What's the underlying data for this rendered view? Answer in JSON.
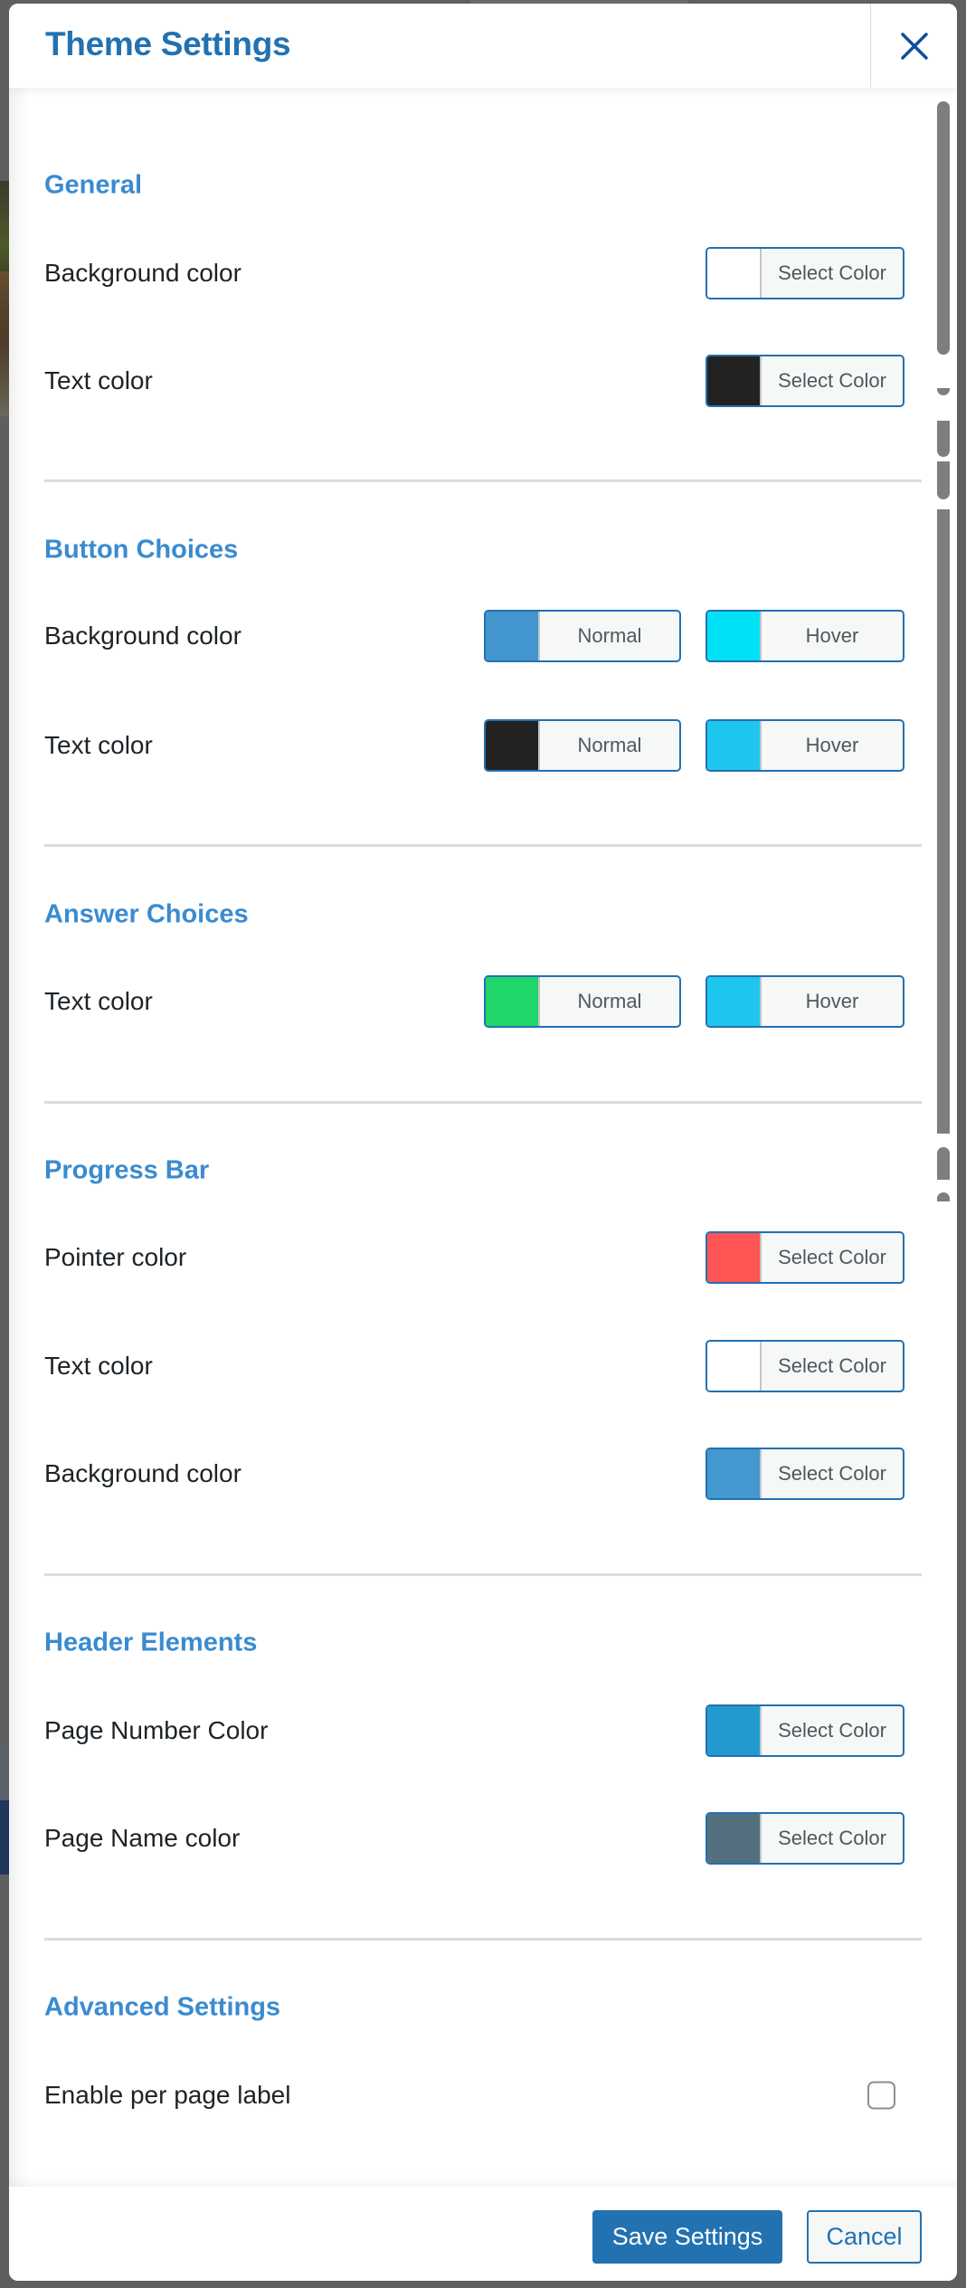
{
  "modal": {
    "title": "Theme Settings",
    "close_icon": "close-icon"
  },
  "sections": {
    "general": {
      "title": "General",
      "rows": [
        {
          "label": "Background color",
          "button_label": "Select Color",
          "color": "#ffffff"
        },
        {
          "label": "Text color",
          "button_label": "Select Color",
          "color": "#222222"
        }
      ]
    },
    "button_choices": {
      "title": "Button Choices",
      "rows": [
        {
          "label": "Background color",
          "normal_label": "Normal",
          "normal_color": "#4396cd",
          "hover_label": "Hover",
          "hover_color": "#00e1f5"
        },
        {
          "label": "Text color",
          "normal_label": "Normal",
          "normal_color": "#222222",
          "hover_label": "Hover",
          "hover_color": "#1ec6ef"
        }
      ]
    },
    "answer_choices": {
      "title": "Answer Choices",
      "rows": [
        {
          "label": "Text color",
          "normal_label": "Normal",
          "normal_color": "#1fd66b",
          "hover_label": "Hover",
          "hover_color": "#1ec6ef"
        }
      ]
    },
    "progress_bar": {
      "title": "Progress Bar",
      "rows": [
        {
          "label": "Pointer color",
          "button_label": "Select Color",
          "color": "#ff5454"
        },
        {
          "label": "Text color",
          "button_label": "Select Color",
          "color": "#ffffff"
        },
        {
          "label": "Background color",
          "button_label": "Select Color",
          "color": "#4399cf"
        }
      ]
    },
    "header_elements": {
      "title": "Header Elements",
      "rows": [
        {
          "label": "Page Number Color",
          "button_label": "Select Color",
          "color": "#229acf"
        },
        {
          "label": "Page Name color",
          "button_label": "Select Color",
          "color": "#54707e"
        }
      ]
    },
    "advanced_settings": {
      "title": "Advanced Settings",
      "rows": [
        {
          "label": "Enable per page label",
          "checked": false
        }
      ]
    }
  },
  "footer": {
    "save_label": "Save Settings",
    "cancel_label": "Cancel"
  },
  "colors": {
    "primary": "#2271b1",
    "section_title": "#3a8bd0"
  }
}
